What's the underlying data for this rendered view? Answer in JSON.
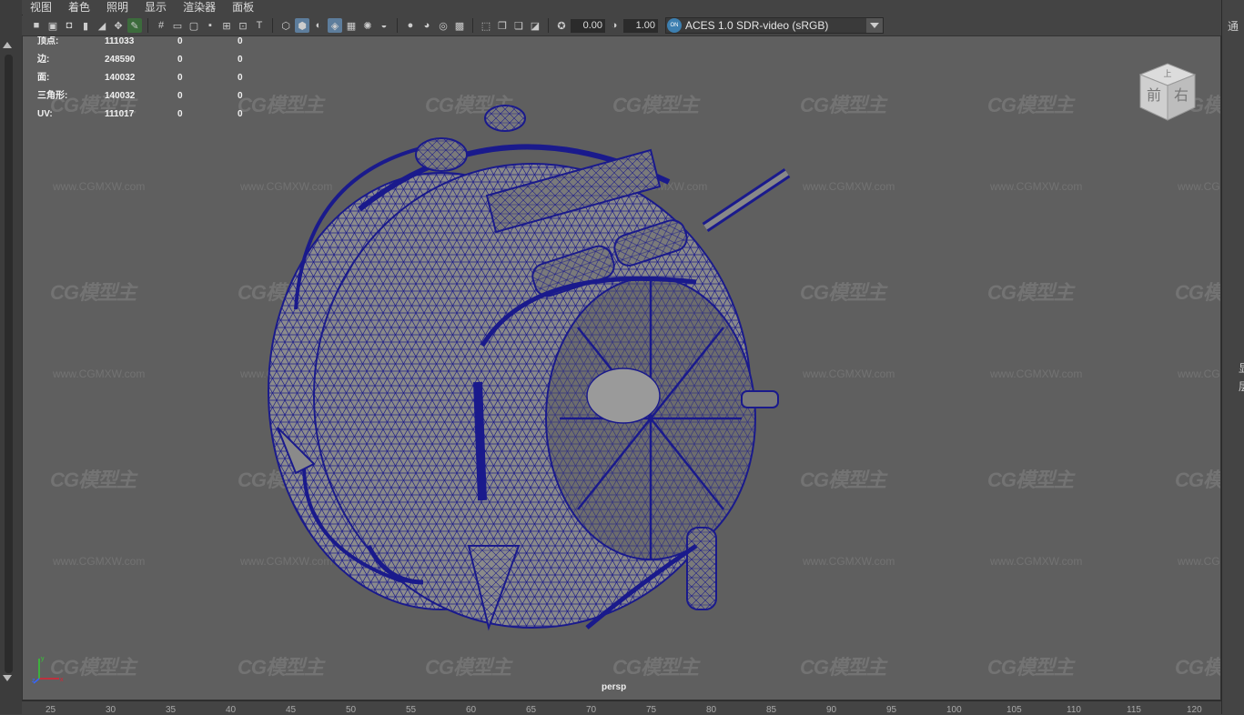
{
  "menu": [
    "视图",
    "着色",
    "照明",
    "显示",
    "渲染器",
    "面板"
  ],
  "toolbar": {
    "exposure_value": "0.00",
    "gamma_value": "1.00",
    "colorspace": "ACES 1.0 SDR-video (sRGB)",
    "colorspace_badge": "ON"
  },
  "hud": {
    "rows": [
      {
        "label": "顶点:",
        "v1": "111033",
        "v2": "0",
        "v3": "0"
      },
      {
        "label": "边:",
        "v1": "248590",
        "v2": "0",
        "v3": "0"
      },
      {
        "label": "面:",
        "v1": "140032",
        "v2": "0",
        "v3": "0"
      },
      {
        "label": "三角形:",
        "v1": "140032",
        "v2": "0",
        "v3": "0"
      },
      {
        "label": "UV:",
        "v1": "111017",
        "v2": "0",
        "v3": "0"
      }
    ]
  },
  "viewport": {
    "camera_label": "persp",
    "viewcube_top": "上",
    "viewcube_front": "前",
    "viewcube_right": "右",
    "axis_x": "x",
    "axis_y": "y",
    "axis_z": "z"
  },
  "watermark": {
    "logo_text": "CG模型主",
    "url_text": "www.CGMXW.com"
  },
  "right_panel": {
    "top_char": "通",
    "mid_char_1": "显",
    "mid_char_2": "层"
  },
  "timeline": {
    "ticks": [
      "25",
      "30",
      "35",
      "40",
      "45",
      "50",
      "55",
      "60",
      "65",
      "70",
      "75",
      "80",
      "85",
      "90",
      "95",
      "100",
      "105",
      "110",
      "115",
      "120"
    ]
  },
  "colors": {
    "viewport_bg": "#5f5f5f",
    "wireframe": "#1a1a8c",
    "mesh_fill": "#8a8a8a",
    "active_tool": "#5d7d9c"
  }
}
